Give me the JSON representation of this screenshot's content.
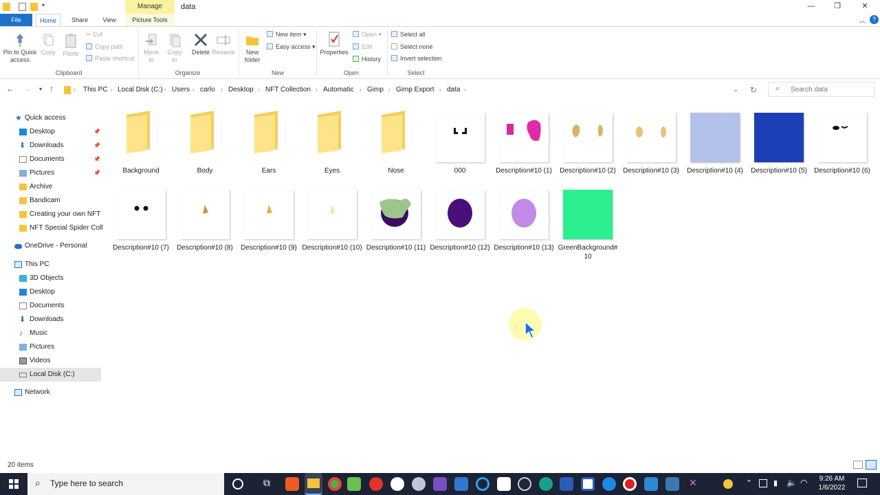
{
  "window": {
    "title": "data",
    "manage_tab": "Manage",
    "picture_tools_tab": "Picture Tools"
  },
  "tabs": {
    "file": "File",
    "home": "Home",
    "share": "Share",
    "view": "View"
  },
  "ribbon": {
    "pin": "Pin to Quick access",
    "copy": "Copy",
    "paste": "Paste",
    "cut": "Cut",
    "copy_path": "Copy path",
    "paste_shortcut": "Paste shortcut",
    "move_to": "Move to",
    "copy_to": "Copy to",
    "delete": "Delete",
    "rename": "Rename",
    "new_folder": "New folder",
    "new_item": "New item",
    "easy_access": "Easy access",
    "properties": "Properties",
    "open": "Open",
    "edit": "Edit",
    "history": "History",
    "select_all": "Select all",
    "select_none": "Select none",
    "invert_selection": "Invert selection",
    "groups": {
      "clipboard": "Clipboard",
      "organize": "Organize",
      "new": "New",
      "open": "Open",
      "select": "Select"
    }
  },
  "breadcrumb": [
    "This PC",
    "Local Disk (C:)",
    "Users",
    "carlo",
    "Desktop",
    "NFT Collection",
    "Automatic",
    "Gimp",
    "Gimp Export",
    "data"
  ],
  "search": {
    "placeholder": "Search data"
  },
  "nav": {
    "quick_access": "Quick access",
    "quick": [
      "Desktop",
      "Downloads",
      "Documents",
      "Pictures",
      "Archive",
      "Bandicam",
      "Creating your own NFT",
      "NFT Special Spider Coll"
    ],
    "onedrive": "OneDrive - Personal",
    "this_pc": "This PC",
    "pc": [
      "3D Objects",
      "Desktop",
      "Documents",
      "Downloads",
      "Music",
      "Pictures",
      "Videos",
      "Local Disk (C:)"
    ],
    "network": "Network"
  },
  "files": [
    {
      "name": "Background",
      "kind": "folder"
    },
    {
      "name": "Body",
      "kind": "folder"
    },
    {
      "name": "Ears",
      "kind": "folder"
    },
    {
      "name": "Eyes",
      "kind": "folder"
    },
    {
      "name": "Nose",
      "kind": "folder"
    },
    {
      "name": "000",
      "kind": "image"
    },
    {
      "name": "Description#10 (1)",
      "kind": "image"
    },
    {
      "name": "Description#10 (2)",
      "kind": "image"
    },
    {
      "name": "Description#10 (3)",
      "kind": "image"
    },
    {
      "name": "Description#10 (4)",
      "kind": "image",
      "color": "#b3c0ea"
    },
    {
      "name": "Description#10 (5)",
      "kind": "image",
      "color": "#1b3fb5"
    },
    {
      "name": "Description#10 (6)",
      "kind": "image"
    },
    {
      "name": "Description#10 (7)",
      "kind": "image"
    },
    {
      "name": "Description#10 (8)",
      "kind": "image"
    },
    {
      "name": "Description#10 (9)",
      "kind": "image"
    },
    {
      "name": "Description#10 (10)",
      "kind": "image"
    },
    {
      "name": "Description#10 (11)",
      "kind": "image"
    },
    {
      "name": "Description#10 (12)",
      "kind": "image",
      "color": "#4a0f7a"
    },
    {
      "name": "Description#10 (13)",
      "kind": "image",
      "color": "#c18ae6"
    },
    {
      "name": "GreenBackground#10",
      "kind": "image",
      "color": "#2cf08f"
    }
  ],
  "status": {
    "count": "20 items"
  },
  "taskbar": {
    "search_placeholder": "Type here to search",
    "time": "9:26 AM",
    "date": "1/6/2022"
  }
}
